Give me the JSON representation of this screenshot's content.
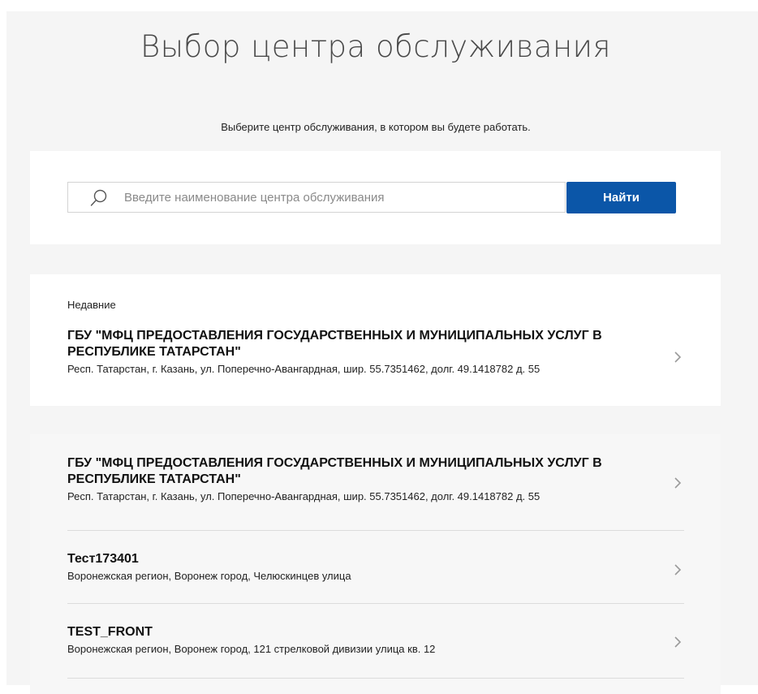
{
  "header": {
    "title": "Выбор центра обслуживания",
    "subtitle": "Выберите центр обслуживания, в котором вы будете работать."
  },
  "search": {
    "placeholder": "Введите наименование центра обслуживания",
    "value": "",
    "button_label": "Найти",
    "icon": "search-icon"
  },
  "recent": {
    "label": "Недавние",
    "items": [
      {
        "name_line1": "ГБУ \"МФЦ ПРЕДОСТАВЛЕНИЯ ГОСУДАРСТВЕННЫХ И МУНИЦИПАЛЬНЫХ УСЛУГ В",
        "name_line2": "РЕСПУБЛИКЕ ТАТАРСТАН\"",
        "address": "Респ. Татарстан, г. Казань, ул. Поперечно-Авангардная, шир. 55.7351462, долг. 49.1418782 д. 55"
      }
    ]
  },
  "centers": {
    "items": [
      {
        "name_line1": "ГБУ \"МФЦ ПРЕДОСТАВЛЕНИЯ ГОСУДАРСТВЕННЫХ И МУНИЦИПАЛЬНЫХ УСЛУГ В",
        "name_line2": "РЕСПУБЛИКЕ ТАТАРСТАН\"",
        "address": "Респ. Татарстан, г. Казань, ул. Поперечно-Авангардная, шир. 55.7351462, долг. 49.1418782 д. 55"
      },
      {
        "name_line1": "Тест173401",
        "address": "Воронежская регион, Воронеж город, Челюскинцев улица"
      },
      {
        "name_line1": "TEST_FRONT",
        "address": "Воронежская регион, Воронеж город, 121 стрелковой дивизии улица кв. 12"
      }
    ]
  },
  "colors": {
    "accent": "#0b56a8",
    "page_background": "#f5f5f5",
    "card_background": "#ffffff"
  }
}
